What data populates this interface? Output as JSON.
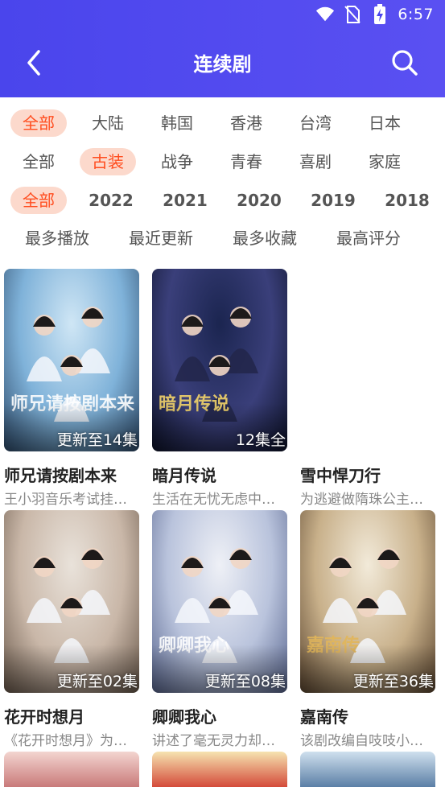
{
  "status_bar": {
    "time": "6:57"
  },
  "header": {
    "title": "连续剧"
  },
  "filters": {
    "region": [
      {
        "label": "全部",
        "active": true
      },
      {
        "label": "大陆"
      },
      {
        "label": "韩国"
      },
      {
        "label": "香港"
      },
      {
        "label": "台湾"
      },
      {
        "label": "日本"
      }
    ],
    "genre": [
      {
        "label": "全部"
      },
      {
        "label": "古装",
        "active": true
      },
      {
        "label": "战争"
      },
      {
        "label": "青春"
      },
      {
        "label": "喜剧"
      },
      {
        "label": "家庭"
      }
    ],
    "year": [
      {
        "label": "全部",
        "active": true
      },
      {
        "label": "2022"
      },
      {
        "label": "2021"
      },
      {
        "label": "2020"
      },
      {
        "label": "2019"
      },
      {
        "label": "2018"
      }
    ],
    "sort": [
      {
        "label": "最多播放"
      },
      {
        "label": "最近更新"
      },
      {
        "label": "最多收藏"
      },
      {
        "label": "最高评分"
      }
    ]
  },
  "cards": [
    {
      "title": "师兄请按剧本来",
      "desc": "王小羽音乐考试挂…",
      "status": "更新至14集",
      "poster_caption": "师兄请按剧本来",
      "colors": [
        "#cfe6f5",
        "#7fb2d9",
        "#2d4a6a"
      ]
    },
    {
      "title": "暗月传说",
      "desc": "生活在无忧无虑中…",
      "status": "12集全",
      "poster_caption": "暗月传说",
      "colors": [
        "#1b2550",
        "#3a3f7a",
        "#0d1228"
      ]
    },
    {
      "title": "雪中悍刀行",
      "desc": "为逃避做隋珠公主…",
      "status": "",
      "poster_caption": "",
      "colors": [],
      "no_poster": true
    },
    {
      "title": "花开时想月",
      "desc": "《花开时想月》为…",
      "status": "更新至02集",
      "poster_caption": "",
      "colors": [
        "#e9e2da",
        "#c9b7a8",
        "#6b5a4c"
      ]
    },
    {
      "title": "卿卿我心",
      "desc": "讲述了毫无灵力却…",
      "status": "更新至08集",
      "poster_caption": "卿卿我心",
      "colors": [
        "#eef0f6",
        "#b9c3dc",
        "#5a6790"
      ]
    },
    {
      "title": "嘉南传",
      "desc": "该剧改编自吱吱小…",
      "status": "更新至36集",
      "poster_caption": "嘉南传",
      "colors": [
        "#f2ead9",
        "#c8b08a",
        "#5c4630"
      ]
    }
  ],
  "partial_cards": [
    {
      "colors": [
        "#f3d5d0",
        "#c97a7a"
      ]
    },
    {
      "colors": [
        "#f6e3b0",
        "#d44b3a"
      ]
    },
    {
      "colors": [
        "#cfe0ee",
        "#5b7fa6"
      ]
    }
  ]
}
